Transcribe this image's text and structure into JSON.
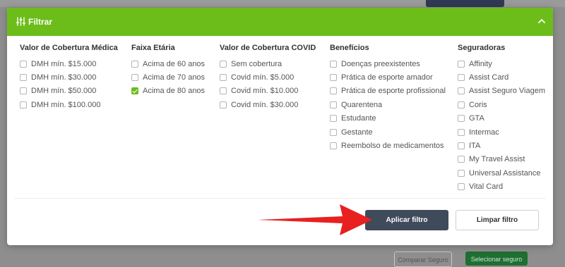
{
  "header": {
    "title": "Filtrar",
    "icon": "sliders-icon",
    "toggle_icon": "chevron-up-icon",
    "color": "#6cbd1a"
  },
  "columns": [
    {
      "title": "Valor de Cobertura Médica",
      "options": [
        {
          "label": "DMH mín. $15.000",
          "checked": false
        },
        {
          "label": "DMH mín. $30.000",
          "checked": false
        },
        {
          "label": "DMH mín. $50.000",
          "checked": false
        },
        {
          "label": "DMH mín. $100.000",
          "checked": false
        }
      ]
    },
    {
      "title": "Faixa Etária",
      "options": [
        {
          "label": "Acima de 60 anos",
          "checked": false
        },
        {
          "label": "Acima de 70 anos",
          "checked": false
        },
        {
          "label": "Acima de 80 anos",
          "checked": true
        }
      ]
    },
    {
      "title": "Valor de Cobertura COVID",
      "options": [
        {
          "label": "Sem cobertura",
          "checked": false
        },
        {
          "label": "Covid mín. $5.000",
          "checked": false
        },
        {
          "label": "Covid mín. $10.000",
          "checked": false
        },
        {
          "label": "Covid mín. $30.000",
          "checked": false
        }
      ]
    },
    {
      "title": "Benefícios",
      "options": [
        {
          "label": "Doenças preexistentes",
          "checked": false
        },
        {
          "label": "Prática de esporte amador",
          "checked": false
        },
        {
          "label": "Prática de esporte profissional",
          "checked": false
        },
        {
          "label": "Quarentena",
          "checked": false
        },
        {
          "label": "Estudante",
          "checked": false
        },
        {
          "label": "Gestante",
          "checked": false
        },
        {
          "label": "Reembolso de medicamentos",
          "checked": false
        }
      ]
    },
    {
      "title": "Seguradoras",
      "options": [
        {
          "label": "Affinity",
          "checked": false
        },
        {
          "label": "Assist Card",
          "checked": false
        },
        {
          "label": "Assist Seguro Viagem",
          "checked": false
        },
        {
          "label": "Coris",
          "checked": false
        },
        {
          "label": "GTA",
          "checked": false
        },
        {
          "label": "Intermac",
          "checked": false
        },
        {
          "label": "ITA",
          "checked": false
        },
        {
          "label": "My Travel Assist",
          "checked": false
        },
        {
          "label": "Universal Assistance",
          "checked": false
        },
        {
          "label": "Vital Card",
          "checked": false
        }
      ]
    }
  ],
  "actions": {
    "apply_label": "Aplicar filtro",
    "clear_label": "Limpar filtro"
  },
  "background": {
    "left_button_label": "Comparar Seguro",
    "right_button_label": "Selecionar seguro"
  },
  "annotation": {
    "icon": "red-arrow-icon",
    "color": "#e8201f"
  }
}
